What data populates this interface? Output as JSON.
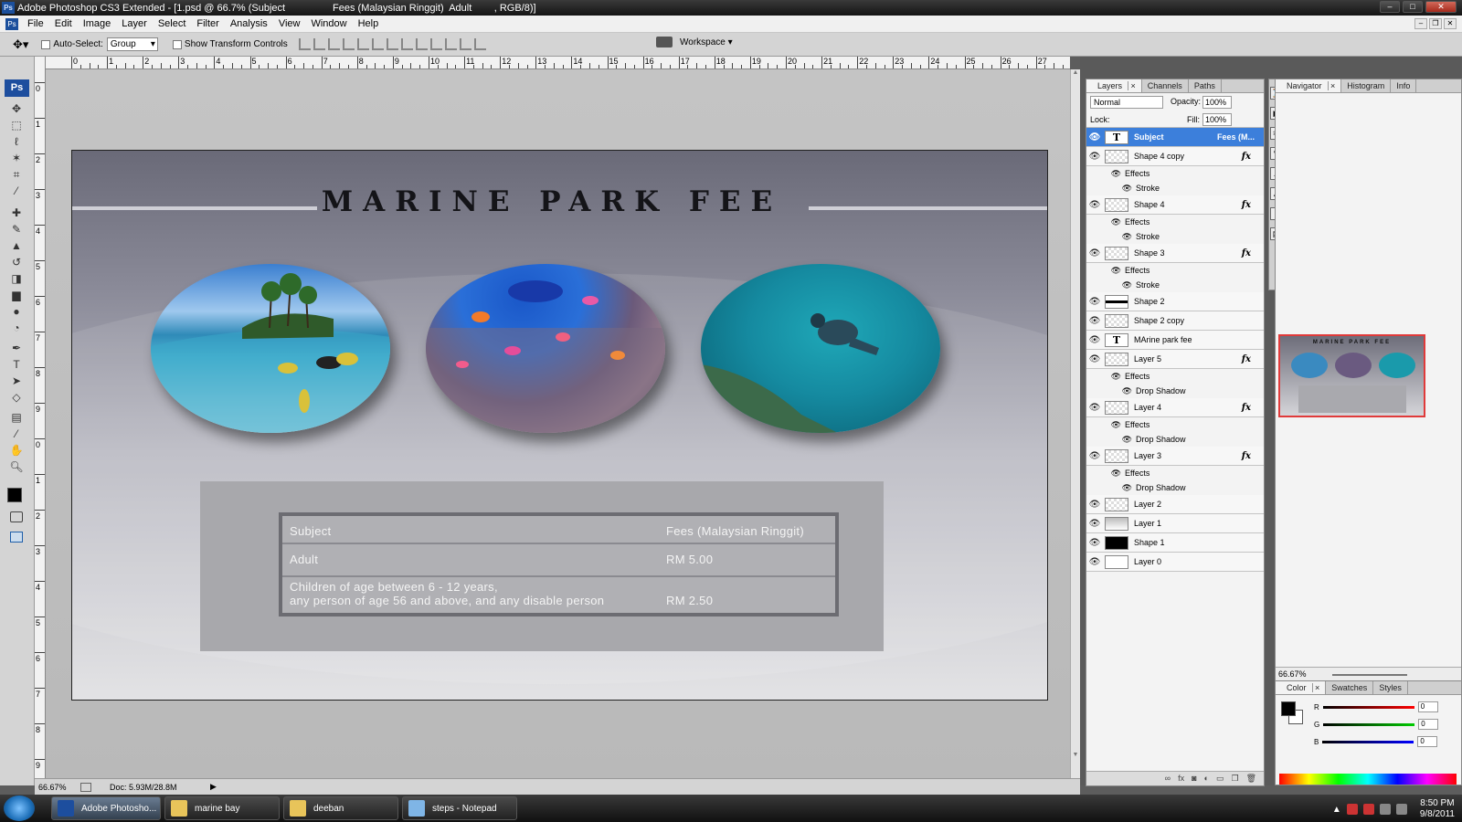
{
  "window": {
    "title": "Adobe Photoshop CS3 Extended - [1.psd @ 66.7% (Subject                 Fees (Malaysian Ringgit)  Adult        , RGB/8)]"
  },
  "menu": [
    "File",
    "Edit",
    "Image",
    "Layer",
    "Select",
    "Filter",
    "Analysis",
    "View",
    "Window",
    "Help"
  ],
  "options": {
    "auto_select_label": "Auto-Select:",
    "auto_select_value": "Group",
    "transform_label": "Show Transform Controls",
    "workspace": "Workspace"
  },
  "ruler_h": [
    "0",
    "1",
    "2",
    "3",
    "4",
    "5",
    "6",
    "7",
    "8",
    "9",
    "10",
    "11",
    "12",
    "13",
    "14",
    "15",
    "16",
    "17",
    "18",
    "19",
    "20",
    "21",
    "22",
    "23",
    "24",
    "25",
    "26",
    "27"
  ],
  "ruler_v": [
    "0",
    "1",
    "2",
    "3",
    "4",
    "5",
    "6",
    "7",
    "8",
    "9",
    "0",
    "1",
    "2",
    "3",
    "4",
    "5",
    "6",
    "7",
    "8",
    "9",
    "2"
  ],
  "document": {
    "heading": "MARINE PARK FEE",
    "table": [
      {
        "subject": "Subject",
        "fee": "Fees (Malaysian Ringgit)"
      },
      {
        "subject": "Adult",
        "fee": "RM 5.00"
      },
      {
        "subject": "Children of age between 6 - 12 years,",
        "subject2": "any person of age 56 and above, and any disable person",
        "fee": "RM 2.50"
      }
    ]
  },
  "status": {
    "zoom": "66.67%",
    "doc": "Doc: 5.93M/28.8M"
  },
  "layers_panel": {
    "tabs": [
      "Layers",
      "Channels",
      "Paths"
    ],
    "blend": "Normal",
    "opacity_label": "Opacity:",
    "opacity": "100%",
    "lock_label": "Lock:",
    "fill_label": "Fill:",
    "fill": "100%",
    "layers": [
      {
        "name": "Subject",
        "extra": "Fees (M...",
        "type": "t",
        "sel": true
      },
      {
        "name": "Shape 4 copy",
        "fx": true
      },
      {
        "name": "Effects",
        "sub": 1
      },
      {
        "name": "Stroke",
        "sub": 2
      },
      {
        "name": "Shape 4",
        "fx": true
      },
      {
        "name": "Effects",
        "sub": 1
      },
      {
        "name": "Stroke",
        "sub": 2
      },
      {
        "name": "Shape 3",
        "fx": true
      },
      {
        "name": "Effects",
        "sub": 1
      },
      {
        "name": "Stroke",
        "sub": 2
      },
      {
        "name": "Shape 2",
        "type": "bar"
      },
      {
        "name": "Shape 2 copy"
      },
      {
        "name": "MArine park fee",
        "type": "t"
      },
      {
        "name": "Layer 5",
        "fx": true
      },
      {
        "name": "Effects",
        "sub": 1
      },
      {
        "name": "Drop Shadow",
        "sub": 2
      },
      {
        "name": "Layer 4",
        "fx": true
      },
      {
        "name": "Effects",
        "sub": 1
      },
      {
        "name": "Drop Shadow",
        "sub": 2
      },
      {
        "name": "Layer 3",
        "fx": true
      },
      {
        "name": "Effects",
        "sub": 1
      },
      {
        "name": "Drop Shadow",
        "sub": 2
      },
      {
        "name": "Layer 2"
      },
      {
        "name": "Layer 1",
        "type": "grad"
      },
      {
        "name": "Shape 1",
        "type": "black"
      },
      {
        "name": "Layer 0",
        "type": "white"
      }
    ]
  },
  "navigator": {
    "tabs": [
      "Navigator",
      "Histogram",
      "Info"
    ],
    "zoom": "66.67%",
    "thumb_title": "MARINE PARK FEE"
  },
  "color_panel": {
    "tabs": [
      "Color",
      "Swatches",
      "Styles"
    ],
    "r_label": "R",
    "g_label": "G",
    "b_label": "B",
    "r": "0",
    "g": "0",
    "b": "0"
  },
  "taskbar": {
    "apps": [
      "Adobe Photosho...",
      "marine bay",
      "deeban",
      "steps - Notepad"
    ],
    "time": "8:50 PM",
    "date": "9/8/2011"
  },
  "colors": {
    "selection": "#3c7fdb",
    "nav_frame": "#e03a3a"
  }
}
